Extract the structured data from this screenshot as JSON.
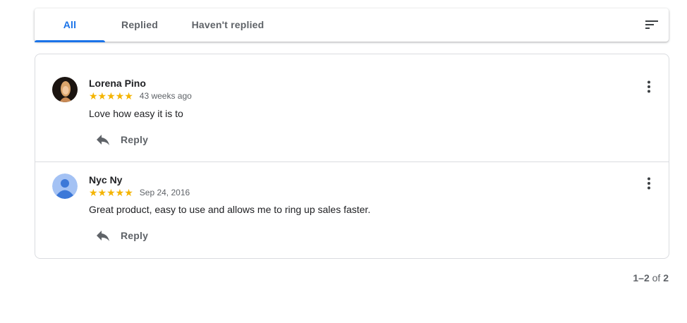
{
  "tabs": [
    {
      "label": "All",
      "active": true
    },
    {
      "label": "Replied",
      "active": false
    },
    {
      "label": "Haven't replied",
      "active": false
    }
  ],
  "filter_icon": "sort-filter-icon",
  "reviews": [
    {
      "author": "Lorena Pino",
      "rating": 5,
      "stars": "★★★★★",
      "date": "43 weeks ago",
      "text": "Love how easy it is to",
      "reply_label": "Reply",
      "avatar": "photo-avatar"
    },
    {
      "author": "Nyc Ny",
      "rating": 5,
      "stars": "★★★★★",
      "date": "Sep 24, 2016",
      "text": "Great product, easy to use and allows me to ring up sales faster.",
      "reply_label": "Reply",
      "avatar": "default-person-avatar"
    }
  ],
  "pagination": {
    "range": "1–2",
    "of": "of",
    "total": "2"
  },
  "colors": {
    "accent": "#1a73e8",
    "star": "#f4b400",
    "muted": "#5f6368",
    "border": "#dadce0"
  }
}
